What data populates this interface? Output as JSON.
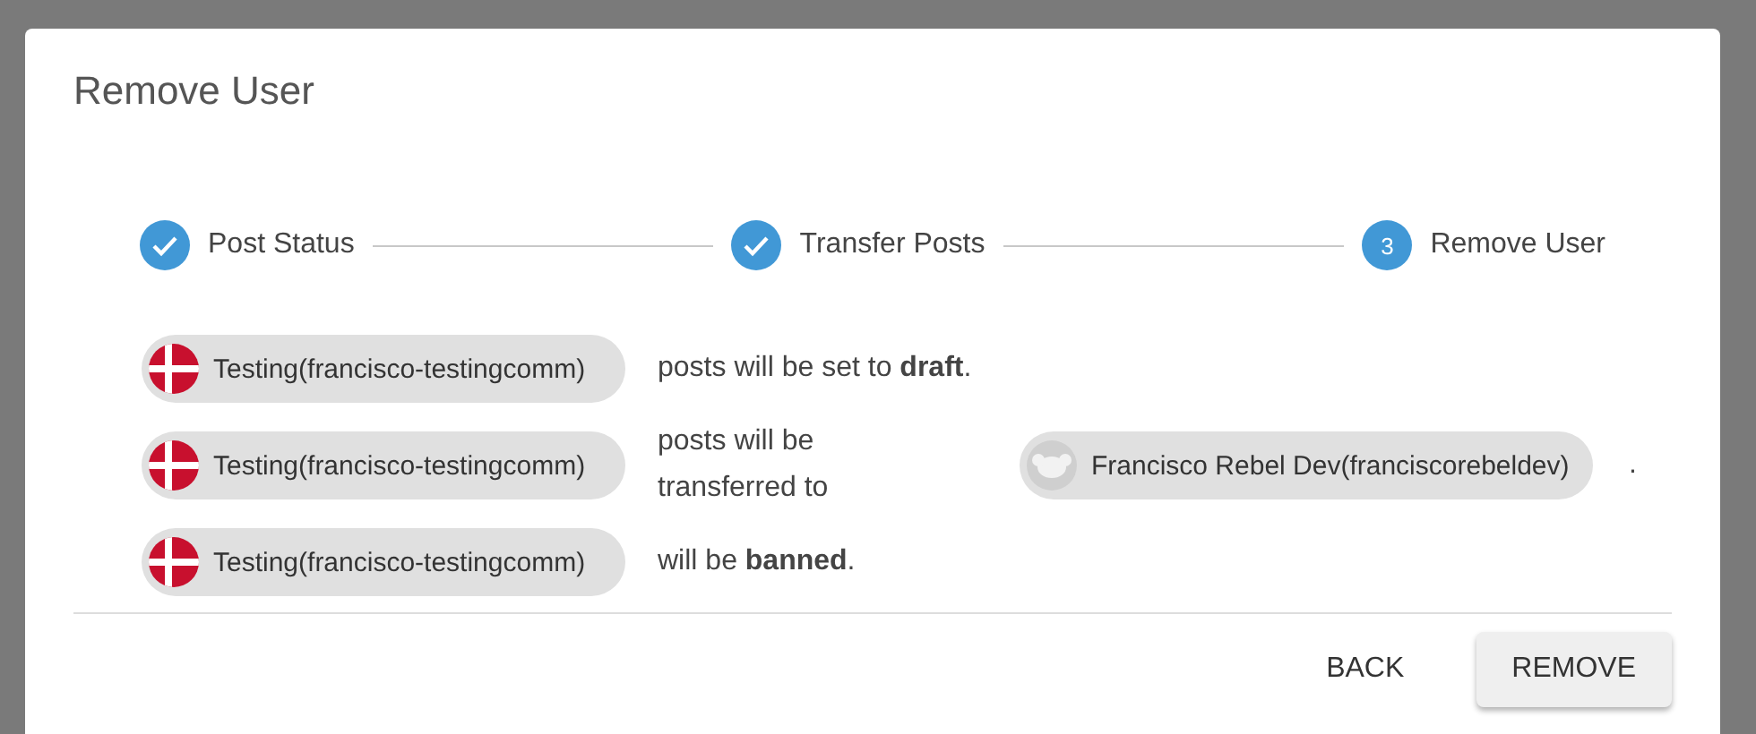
{
  "dialog": {
    "title": "Remove User",
    "steps": [
      {
        "label": "Post Status",
        "completed": true
      },
      {
        "label": "Transfer Posts",
        "completed": true
      },
      {
        "label": "Remove User",
        "completed": false,
        "number": "3"
      }
    ],
    "rows": [
      {
        "user": {
          "name": "Testing(francisco-testingcomm)",
          "kind": "flag"
        },
        "text": "posts will be set to **draft**."
      },
      {
        "user": {
          "name": "Testing(francisco-testingcomm)",
          "kind": "flag"
        },
        "text": "posts will be transferred to",
        "target": {
          "name": "Francisco Rebel Dev(franciscorebeldev)",
          "kind": "mascot"
        },
        "trailing": "."
      },
      {
        "user": {
          "name": "Testing(francisco-testingcomm)",
          "kind": "flag"
        },
        "text": "will be **banned**."
      }
    ],
    "buttons": [
      {
        "label": "BACK",
        "kind": "text"
      },
      {
        "label": "REMOVE",
        "kind": "raised"
      }
    ]
  }
}
